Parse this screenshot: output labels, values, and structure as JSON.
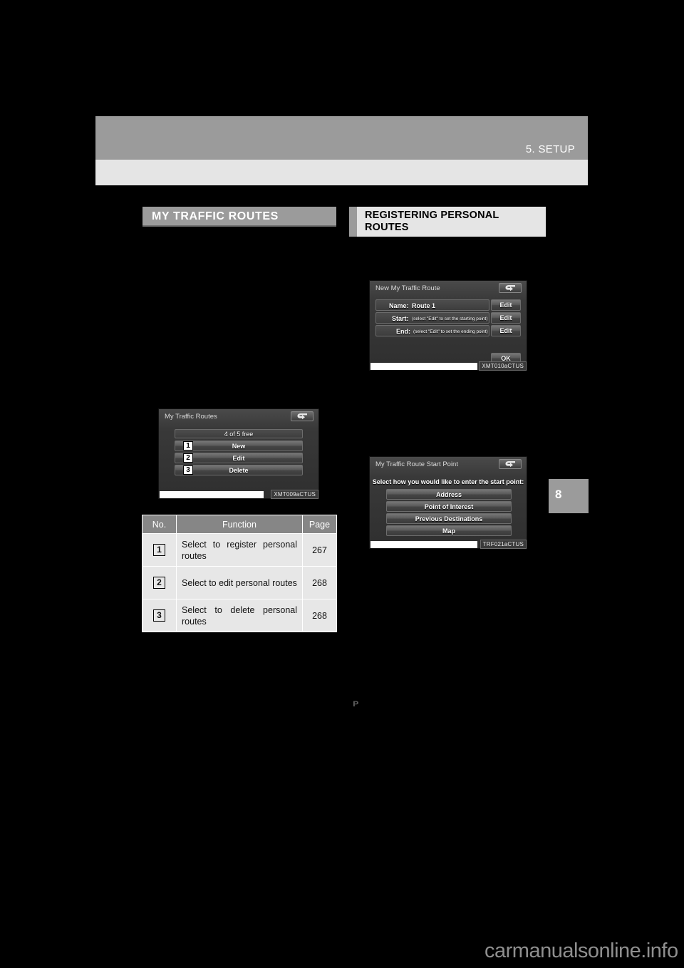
{
  "header": {
    "chapter_title": "5. SETUP",
    "side_tab_number": "8"
  },
  "sections": {
    "left_heading": "MY TRAFFIC ROUTES",
    "right_heading": "REGISTERING PERSONAL ROUTES"
  },
  "screenshot_my_traffic_routes": {
    "title": "My Traffic Routes",
    "caption": "XMT009aCTUS",
    "back_icon": "back-arrow-icon",
    "status_bar": "4  of 5 free",
    "buttons": [
      {
        "number": "1",
        "label": "New"
      },
      {
        "number": "2",
        "label": "Edit"
      },
      {
        "number": "3",
        "label": "Delete"
      }
    ]
  },
  "screenshot_new_my_traffic_route": {
    "title": "New My Traffic Route",
    "caption": "XMT010aCTUS",
    "back_icon": "back-arrow-icon",
    "rows": [
      {
        "label": "Name:",
        "value": "Route 1",
        "button": "Edit"
      },
      {
        "label": "Start:",
        "value": "(select \"Edit\" to set the starting point)",
        "button": "Edit"
      },
      {
        "label": "End:",
        "value": "(select \"Edit\" to set the ending point)",
        "button": "Edit"
      }
    ],
    "ok_label": "OK"
  },
  "screenshot_start_point": {
    "title": "My Traffic Route Start Point",
    "caption": "TRF021aCTUS",
    "back_icon": "back-arrow-icon",
    "prompt": "Select how you would like to enter the start point:",
    "buttons": [
      "Address",
      "Point of Interest",
      "Previous Destinations",
      "Map"
    ]
  },
  "function_table": {
    "headers": {
      "no": "No.",
      "function": "Function",
      "page": "Page"
    },
    "rows": [
      {
        "no": "1",
        "function": "Select to register personal routes",
        "page": "267"
      },
      {
        "no": "2",
        "function": "Select to edit personal routes",
        "page": "268"
      },
      {
        "no": "3",
        "function": "Select to delete personal routes",
        "page": "268"
      }
    ]
  },
  "misc": {
    "tiny_mark": "ᴩ",
    "watermark": "carmanualsonline.info"
  }
}
